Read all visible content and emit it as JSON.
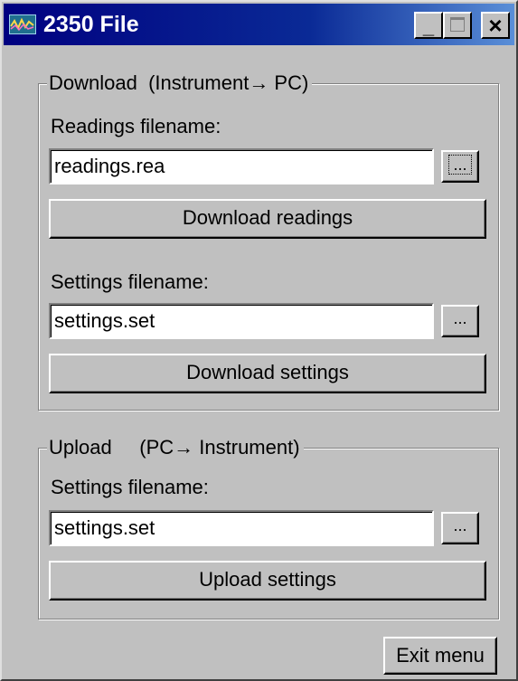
{
  "window": {
    "title": "2350 File"
  },
  "download": {
    "group_label": "Download  (Instrument→ PC)",
    "readings_label": "Readings filename:",
    "readings_value": "readings.rea",
    "browse_label": "...",
    "download_readings_label": "Download readings",
    "settings_label": "Settings filename:",
    "settings_value": "settings.set",
    "download_settings_label": "Download settings"
  },
  "upload": {
    "group_label": "Upload     (PC→ Instrument)",
    "settings_label": "Settings filename:",
    "settings_value": "settings.set",
    "browse_label": "...",
    "upload_settings_label": "Upload settings"
  },
  "footer": {
    "exit_label": "Exit menu"
  },
  "colors": {
    "face": "#c0c0c0",
    "title_start": "#000080",
    "title_end": "#5a8fd8"
  }
}
